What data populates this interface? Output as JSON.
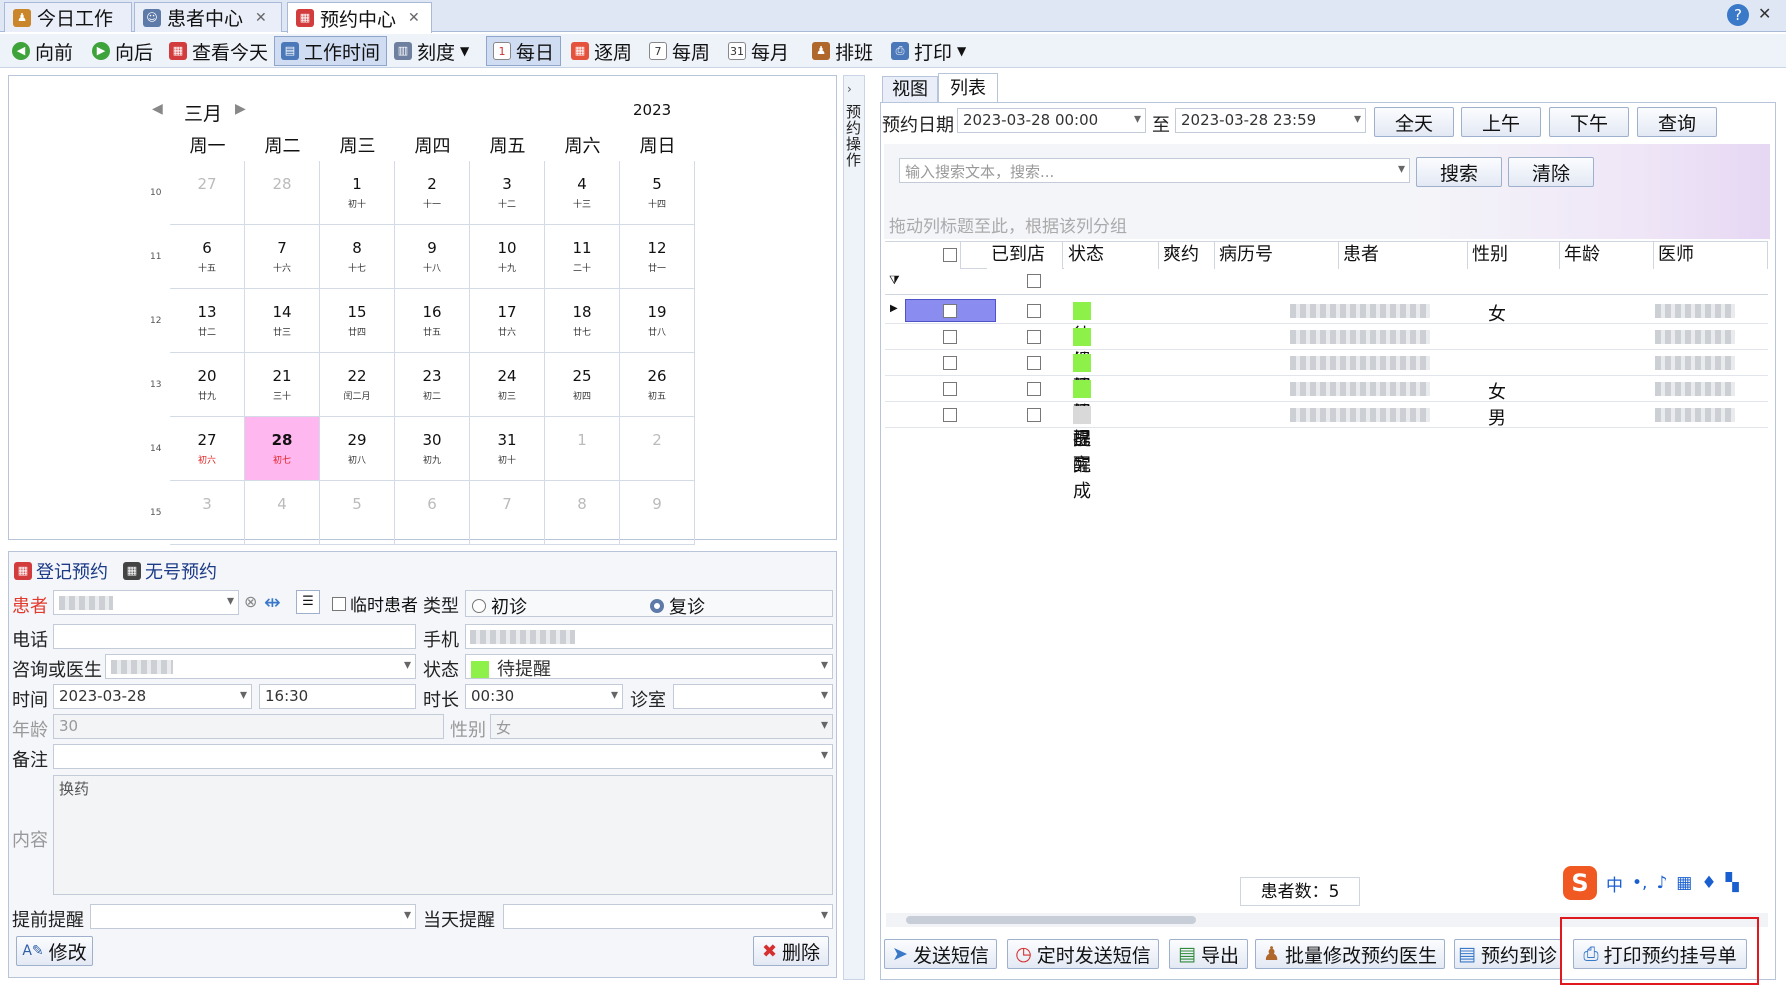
{
  "tabs": [
    {
      "label": "今日工作",
      "active": false
    },
    {
      "label": "患者中心",
      "active": false
    },
    {
      "label": "预约中心",
      "active": true
    }
  ],
  "toolbar": {
    "prev": "向前",
    "next": "向后",
    "today": "查看今天",
    "work_time": "工作时间",
    "scale": "刻度",
    "daily": "每日",
    "per_week": "逐周",
    "weekly": "每周",
    "monthly": "每月",
    "schedule": "排班",
    "print": "打印"
  },
  "calendar": {
    "month": "三月",
    "year": "2023",
    "weekdays": [
      "周一",
      "周二",
      "周三",
      "周四",
      "周五",
      "周六",
      "周日"
    ],
    "weeks": [
      "10",
      "11",
      "12",
      "13",
      "14",
      "15"
    ],
    "days": [
      [
        "27",
        "",
        "o"
      ],
      [
        "28",
        "",
        "o"
      ],
      [
        "1",
        "初十",
        ""
      ],
      [
        "2",
        "十一",
        ""
      ],
      [
        "3",
        "十二",
        ""
      ],
      [
        "4",
        "十三",
        ""
      ],
      [
        "5",
        "十四",
        ""
      ],
      [
        "6",
        "十五",
        ""
      ],
      [
        "7",
        "十六",
        ""
      ],
      [
        "8",
        "十七",
        ""
      ],
      [
        "9",
        "十八",
        ""
      ],
      [
        "10",
        "十九",
        ""
      ],
      [
        "11",
        "二十",
        ""
      ],
      [
        "12",
        "廿一",
        ""
      ],
      [
        "13",
        "廿二",
        ""
      ],
      [
        "14",
        "廿三",
        ""
      ],
      [
        "15",
        "廿四",
        ""
      ],
      [
        "16",
        "廿五",
        ""
      ],
      [
        "17",
        "廿六",
        ""
      ],
      [
        "18",
        "廿七",
        ""
      ],
      [
        "19",
        "廿八",
        ""
      ],
      [
        "20",
        "廿九",
        ""
      ],
      [
        "21",
        "三十",
        ""
      ],
      [
        "22",
        "闰二月",
        ""
      ],
      [
        "23",
        "初二",
        ""
      ],
      [
        "24",
        "初三",
        ""
      ],
      [
        "25",
        "初四",
        ""
      ],
      [
        "26",
        "初五",
        ""
      ],
      [
        "27",
        "初六",
        "r"
      ],
      [
        "28",
        "初七",
        "t"
      ],
      [
        "29",
        "初八",
        ""
      ],
      [
        "30",
        "初九",
        ""
      ],
      [
        "31",
        "初十",
        ""
      ],
      [
        "1",
        "",
        "o"
      ],
      [
        "2",
        "",
        "o"
      ],
      [
        "3",
        "",
        "o"
      ],
      [
        "4",
        "",
        "o"
      ],
      [
        "5",
        "",
        "o"
      ],
      [
        "6",
        "",
        "o"
      ],
      [
        "7",
        "",
        "o"
      ],
      [
        "8",
        "",
        "o"
      ],
      [
        "9",
        "",
        "o"
      ]
    ],
    "side_label": "预约操作"
  },
  "form": {
    "tab_register": "登记预约",
    "tab_noreg": "无号预约",
    "patient_label": "患者",
    "temp_patient": "临时患者",
    "type_label": "类型",
    "first_visit": "初诊",
    "revisit": "复诊",
    "phone_label": "电话",
    "mobile_label": "手机",
    "consult_label": "咨询或医生",
    "status_label": "状态",
    "status_value": "待提醒",
    "time_label": "时间",
    "date_value": "2023-03-28",
    "time_value": "16:30",
    "duration_label": "时长",
    "duration_value": "00:30",
    "room_label": "诊室",
    "age_label": "年龄",
    "age_value": "30",
    "gender_label": "性别",
    "gender_value": "女",
    "remark_label": "备注",
    "content_label": "内容",
    "content_value": "换药",
    "pre_remind_label": "提前提醒",
    "day_remind_label": "当天提醒",
    "modify_btn": "修改",
    "delete_btn": "删除"
  },
  "list": {
    "tab_view": "视图",
    "tab_list": "列表",
    "date_label": "预约日期",
    "from": "2023-03-28 00:00",
    "to_label": "至",
    "to": "2023-03-28 23:59",
    "all_day": "全天",
    "morning": "上午",
    "afternoon": "下午",
    "query": "查询",
    "search_placeholder": "输入搜索文本，搜索...",
    "search_btn": "搜索",
    "clear_btn": "清除",
    "group_hint": "拖动列标题至此，根据该列分组",
    "columns": [
      "已到店",
      "状态",
      "爽约",
      "病历号",
      "患者",
      "性别",
      "年龄",
      "医师"
    ],
    "rows": [
      {
        "status": "待提醒",
        "gender": "女"
      },
      {
        "status": "待提醒",
        "gender": ""
      },
      {
        "status": "待提醒",
        "gender": ""
      },
      {
        "status": "待提醒",
        "gender": "女"
      },
      {
        "status": "已完成",
        "gender": "男"
      }
    ],
    "patient_count": "患者数：5"
  },
  "actions": {
    "send_sms": "发送短信",
    "timed_sms": "定时发送短信",
    "export": "导出",
    "batch_doctor": "批量修改预约医生",
    "to_visit": "预约到诊",
    "print_reg": "打印预约挂号单"
  },
  "ime": {
    "lang": "中",
    "punct": "•,"
  },
  "colors": {
    "today": "#ffb7f0",
    "status_pending": "#8ef14a",
    "status_done": "#d9d9d9",
    "highlight_box": "#e0191f"
  }
}
